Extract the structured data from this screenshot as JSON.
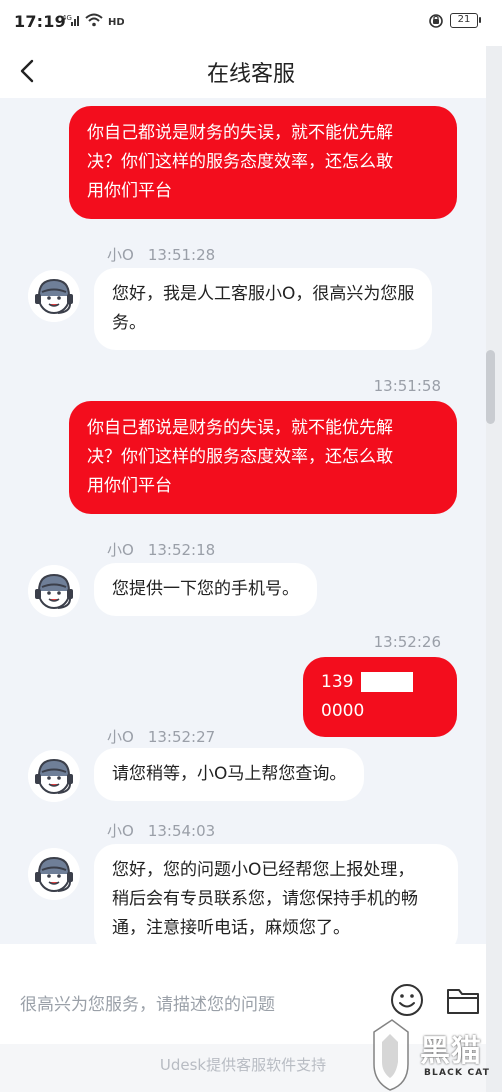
{
  "status_bar": {
    "time": "17:19",
    "battery": "21"
  },
  "header": {
    "title": "在线客服"
  },
  "messages": [
    {
      "side": "right",
      "text": "你自己都说是财务的失误，就不能优先解决？你们这样的服务态度效率，还怎么敢用你们平台"
    },
    {
      "side": "left",
      "sender": "小O",
      "time": "13:51:28",
      "text": "您好，我是人工客服小O，很高兴为您服务。"
    },
    {
      "side": "right",
      "time": "13:51:58",
      "text": "你自己都说是财务的失误，就不能优先解决？你们这样的服务态度效率，还怎么敢用你们平台"
    },
    {
      "side": "left",
      "sender": "小O",
      "time": "13:52:18",
      "text": "您提供一下您的手机号。"
    },
    {
      "side": "right",
      "time": "13:52:26",
      "text": "139 0000"
    },
    {
      "side": "left",
      "sender": "小O",
      "time": "13:52:27",
      "text": "请您稍等，小O马上帮您查询。"
    },
    {
      "side": "left",
      "sender": "小O",
      "time": "13:54:03",
      "text": "您好，您的问题小O已经帮您上报处理，稍后会有专员联系您，请您保持手机的畅通，注意接听电话，麻烦您了。"
    }
  ],
  "message_lines": {
    "m0": [
      "你自己都说是财务的失误，就不能优先解",
      "决？你们这样的服务态度效率，还怎么敢",
      "用你们平台"
    ],
    "m1": [
      "您好，我是人工客服小O，很高兴为您服",
      "务。"
    ],
    "m2": [
      "你自己都说是财务的失误，就不能优先解",
      "决？你们这样的服务态度效率，还怎么敢",
      "用你们平台"
    ],
    "m3": [
      "您提供一下您的手机号。"
    ],
    "m4": [
      "139",
      "0000"
    ],
    "m5": [
      "请您稍等，小O马上帮您查询。"
    ],
    "m6": [
      "您好，您的问题小O已经帮您上报处理，",
      "稍后会有专员联系您，请您保持手机的畅",
      "通，注意接听电话，麻烦您了。"
    ]
  },
  "input": {
    "placeholder": "很高兴为您服务，请描述您的问题"
  },
  "footer": {
    "text": "Udesk提供客服软件支持"
  },
  "watermark": {
    "text_zh": "黑猫",
    "text_en": "BLACK CAT"
  },
  "icons": [
    "back-arrow-icon",
    "agent-avatar-icon",
    "emoji-icon",
    "folder-icon",
    "wifi-icon",
    "signal-icon",
    "alarm-icon",
    "battery-icon"
  ],
  "colors": {
    "accent": "#f30d1d",
    "bubble_left": "#ffffff",
    "chat_bg": "#f1f4f9"
  }
}
